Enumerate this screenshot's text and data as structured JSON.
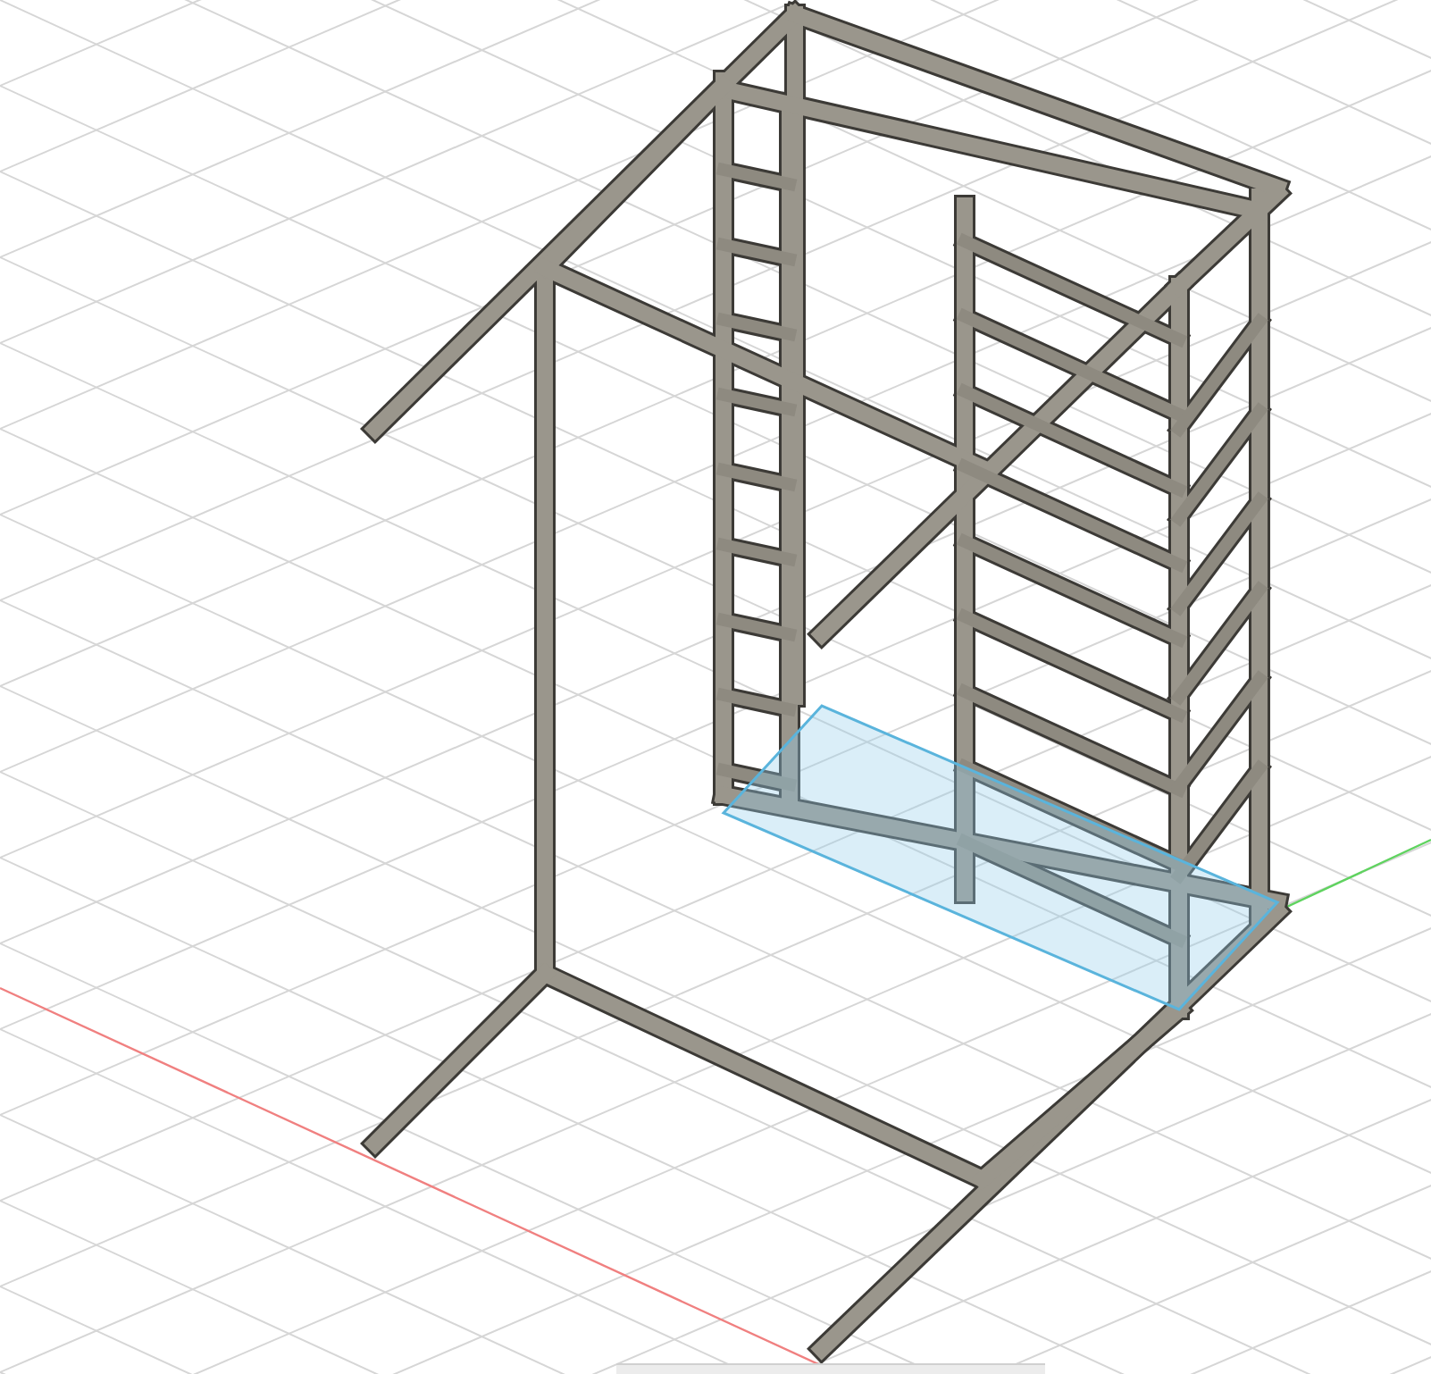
{
  "viewport": {
    "parts": [
      {
        "kind": "frame",
        "selected": false
      },
      {
        "kind": "floor-panel",
        "selected": true
      }
    ]
  },
  "toolbar": {
    "visible": true
  }
}
